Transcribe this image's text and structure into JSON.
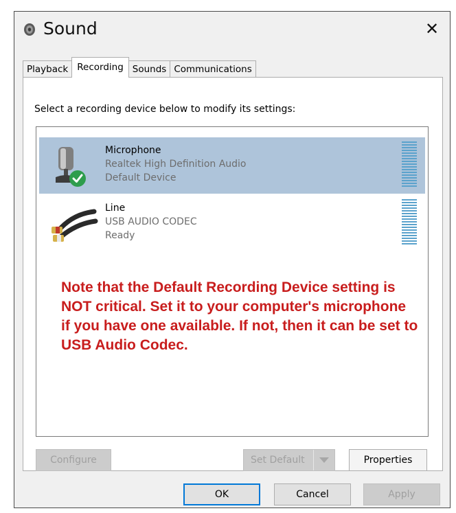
{
  "window": {
    "title": "Sound",
    "icon": "speaker-icon",
    "close_icon": "close-icon",
    "close_glyph": "✕"
  },
  "tabs": [
    {
      "label": "Playback",
      "active": false
    },
    {
      "label": "Recording",
      "active": true
    },
    {
      "label": "Sounds",
      "active": false
    },
    {
      "label": "Communications",
      "active": false
    }
  ],
  "panel": {
    "instruction": "Select a recording device below to modify its settings:"
  },
  "devices": [
    {
      "name": "Microphone",
      "driver": "Realtek High Definition Audio",
      "status": "Default Device",
      "icon": "microphone-icon",
      "badge": "default-check-icon",
      "selected": true
    },
    {
      "name": "Line",
      "driver": "USB AUDIO  CODEC",
      "status": "Ready",
      "icon": "rca-cable-icon",
      "selected": false
    }
  ],
  "annotation": {
    "text": "Note that the Default Recording Device setting is NOT critical.  Set it to your computer's microphone if you have one available.  If not, then it can be set to USB Audio Codec.",
    "color": "#c81d1d"
  },
  "buttons": {
    "configure": "Configure",
    "set_default": "Set Default",
    "properties": "Properties",
    "ok": "OK",
    "cancel": "Cancel",
    "apply": "Apply"
  },
  "colors": {
    "selection": "#aec4da",
    "meter": "#5aa2cc",
    "window_bg": "#f0f0f0",
    "default_badge": "#2e9d4c"
  }
}
